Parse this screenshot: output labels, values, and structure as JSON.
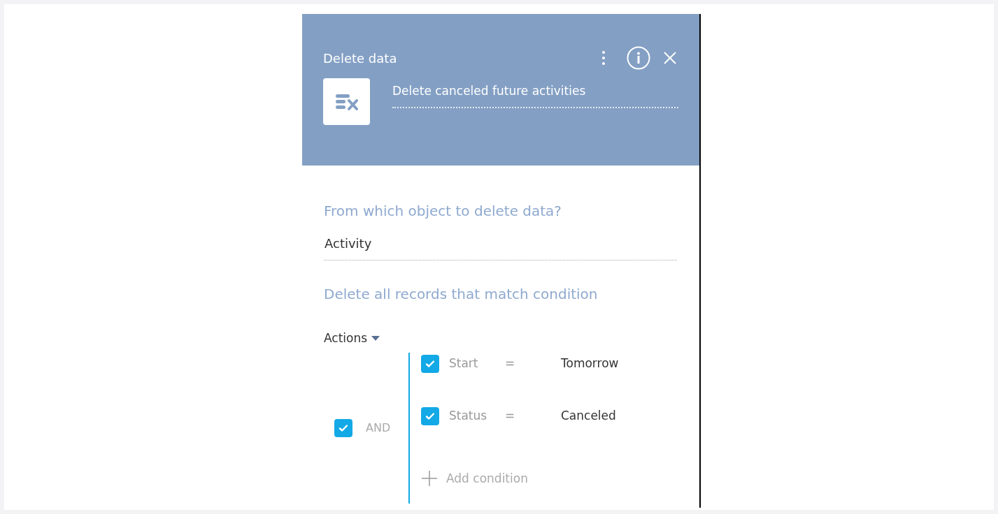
{
  "header": {
    "title": "Delete data",
    "process_name": "Delete canceled future activities"
  },
  "object_section": {
    "label": "From which object to delete data?",
    "value": "Activity"
  },
  "condition_section": {
    "label": "Delete all records that match condition",
    "actions_label": "Actions",
    "group": {
      "operator": "AND",
      "checked": true,
      "conditions": [
        {
          "column": "Start",
          "comparison": "=",
          "value": "Tomorrow",
          "checked": true
        },
        {
          "column": "Status",
          "comparison": "=",
          "value": "Canceled",
          "checked": true
        }
      ],
      "add_label": "Add condition"
    }
  }
}
